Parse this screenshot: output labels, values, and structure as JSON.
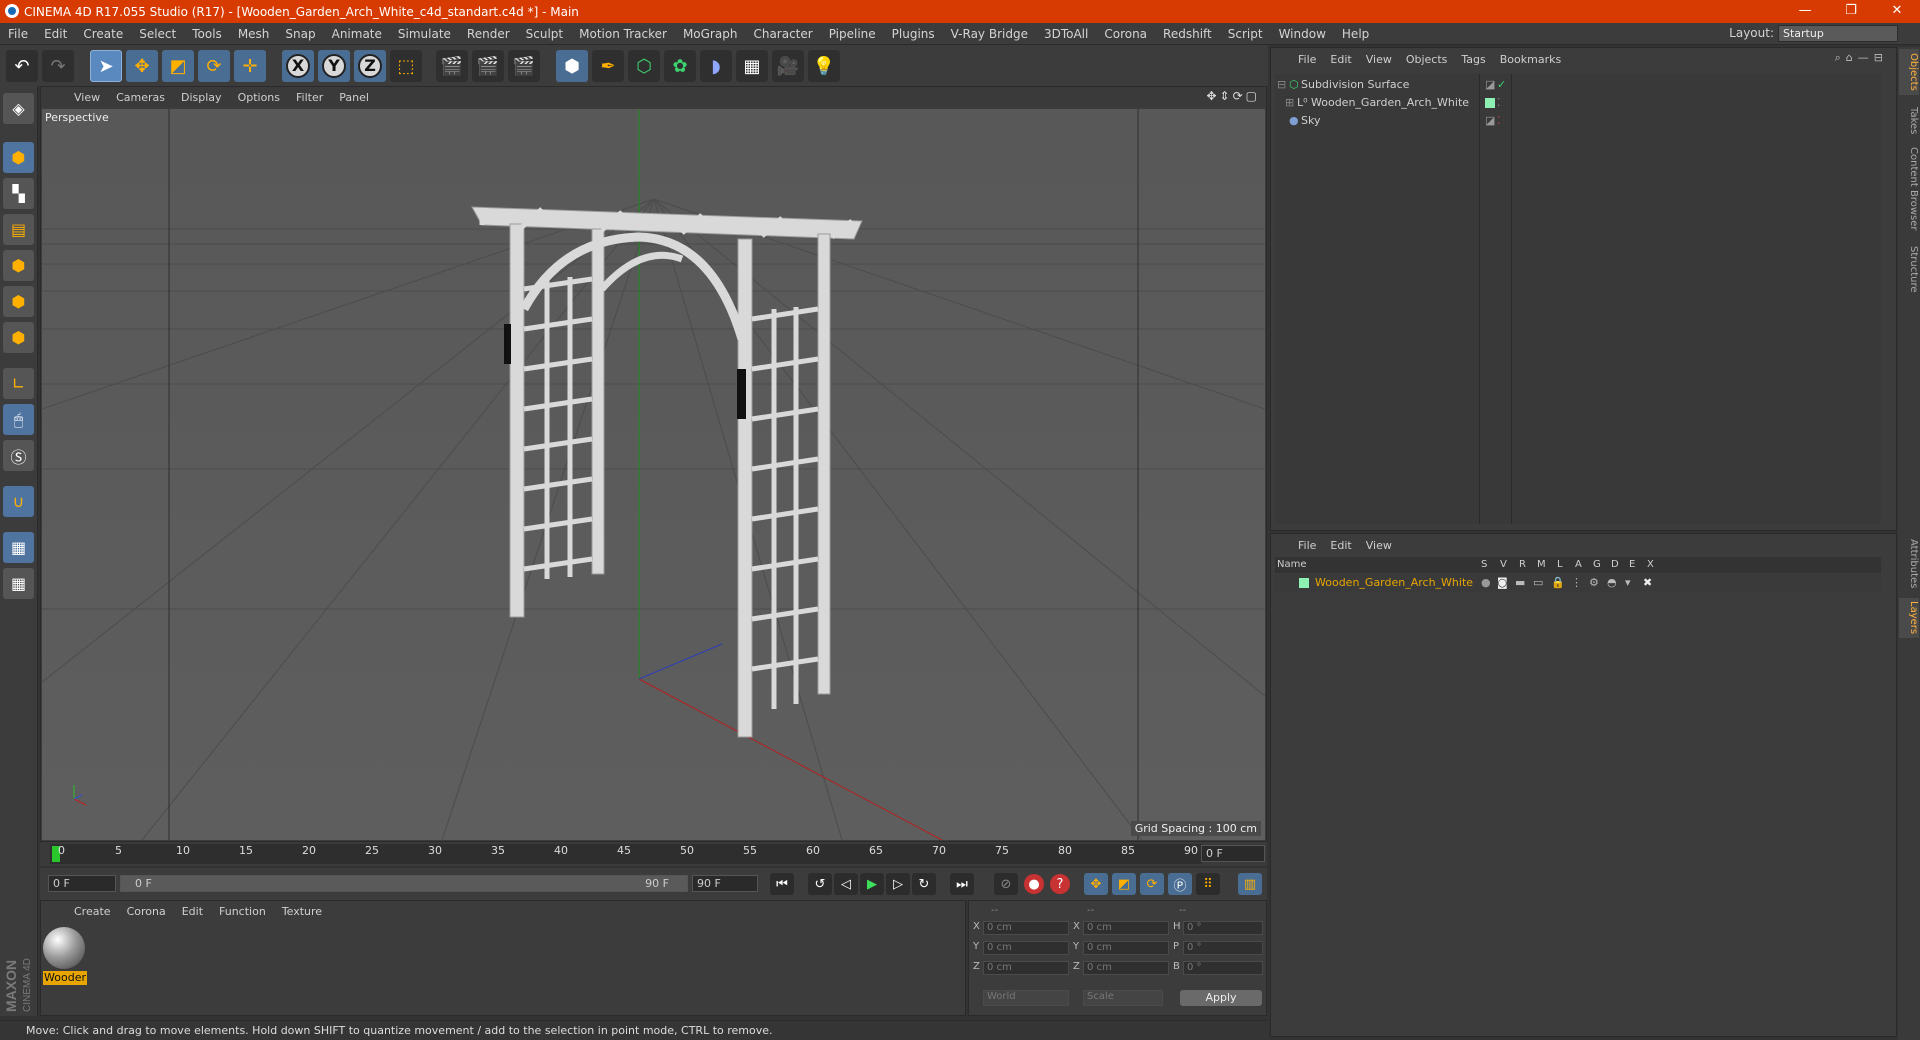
{
  "window": {
    "title": "CINEMA 4D R17.055 Studio (R17) - [Wooden_Garden_Arch_White_c4d_standart.c4d *] - Main",
    "minimize": "—",
    "restore": "❐",
    "close": "✕"
  },
  "menubar": {
    "items": [
      "File",
      "Edit",
      "Create",
      "Select",
      "Tools",
      "Mesh",
      "Snap",
      "Animate",
      "Simulate",
      "Render",
      "Sculpt",
      "Motion Tracker",
      "MoGraph",
      "Character",
      "Pipeline",
      "Plugins",
      "V-Ray Bridge",
      "3DToAll",
      "Corona",
      "Redshift",
      "Script",
      "Window",
      "Help"
    ],
    "layout_label": "Layout:",
    "layout_value": "Startup"
  },
  "viewport": {
    "menu": [
      "View",
      "Cameras",
      "Display",
      "Options",
      "Filter",
      "Panel"
    ],
    "label": "Perspective",
    "grid_spacing": "Grid Spacing : 100 cm"
  },
  "timeline": {
    "ticks": [
      "0",
      "5",
      "10",
      "15",
      "20",
      "25",
      "30",
      "35",
      "40",
      "45",
      "50",
      "55",
      "60",
      "65",
      "70",
      "75",
      "80",
      "85",
      "90"
    ],
    "current_frame": "0 F",
    "start_field": "0 F",
    "range_start": "0 F",
    "range_end": "90 F",
    "end_field": "90 F"
  },
  "materials": {
    "menu": [
      "Create",
      "Corona",
      "Edit",
      "Function",
      "Texture"
    ],
    "items": [
      {
        "name": "Wooder"
      }
    ]
  },
  "coords": {
    "headers": [
      "--",
      "--",
      "--"
    ],
    "rows": [
      {
        "a": "X",
        "av": "0 cm",
        "b": "X",
        "bv": "0 cm",
        "c": "H",
        "cv": "0 °"
      },
      {
        "a": "Y",
        "av": "0 cm",
        "b": "Y",
        "bv": "0 cm",
        "c": "P",
        "cv": "0 °"
      },
      {
        "a": "Z",
        "av": "0 cm",
        "b": "Z",
        "bv": "0 cm",
        "c": "B",
        "cv": "0 °"
      }
    ],
    "space": "World",
    "mode": "Scale",
    "apply": "Apply"
  },
  "status": "Move: Click and drag to move elements. Hold down SHIFT to quantize movement / add to the selection in point mode, CTRL to remove.",
  "objects_panel": {
    "menu": [
      "File",
      "Edit",
      "View",
      "Objects",
      "Tags",
      "Bookmarks"
    ],
    "rows": [
      {
        "name": "Subdivision Surface",
        "color": "#cfd8cf"
      },
      {
        "name": "Wooden_Garden_Arch_White",
        "color": "#cfcfcf"
      },
      {
        "name": "Sky",
        "color": "#cfcfcf"
      }
    ]
  },
  "layers_panel": {
    "menu": [
      "File",
      "Edit",
      "View"
    ],
    "columns": [
      "Name",
      "S",
      "V",
      "R",
      "M",
      "L",
      "A",
      "G",
      "D",
      "E",
      "X"
    ],
    "rows": [
      {
        "name": "Wooden_Garden_Arch_White",
        "color": "#e8a500",
        "swatch": "#8ff0b4"
      }
    ]
  },
  "side_tabs": [
    "Objects",
    "Takes",
    "Content Browser",
    "Structure",
    "Attributes",
    "Layers"
  ],
  "brand": {
    "maxon": "MAXON",
    "c4d": "CINEMA 4D"
  }
}
